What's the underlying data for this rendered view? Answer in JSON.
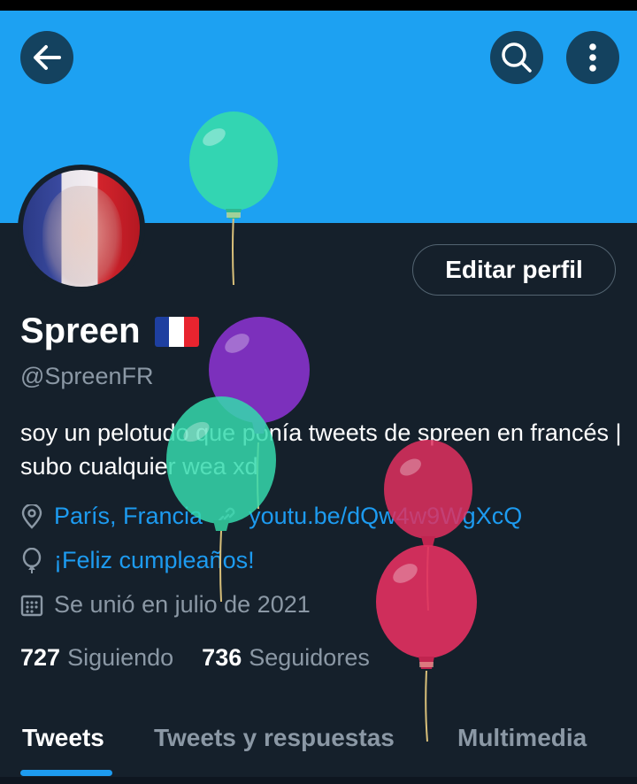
{
  "header": {
    "back_icon": "arrow-left-icon",
    "search_icon": "search-icon",
    "more_icon": "more-vertical-icon",
    "banner_color": "#1da1f2"
  },
  "profile": {
    "name": "Spreen",
    "handle": "@SpreenFR",
    "bio": "soy un pelotudo que ponía tweets de spreen en francés | subo cualquier wea xd",
    "edit_button": "Editar perfil",
    "location": "París, Francia",
    "website": "youtu.be/dQw4w9WgXcQ",
    "birthday": "¡Feliz cumpleaños!",
    "joined": "Se unió en julio de 2021",
    "following_count": "727",
    "following_label": "Siguiendo",
    "followers_count": "736",
    "followers_label": "Seguidores"
  },
  "tabs": [
    {
      "label": "Tweets",
      "active": true
    },
    {
      "label": "Tweets y respuestas",
      "active": false
    },
    {
      "label": "Multimedia",
      "active": false
    }
  ],
  "colors": {
    "background": "#15202b",
    "accent": "#1d9bf0",
    "muted": "#8b98a5"
  },
  "balloons": [
    {
      "color": "#35d9ad"
    },
    {
      "color": "#8b32d0"
    },
    {
      "color": "#35d9ad"
    },
    {
      "color": "#e0305f"
    },
    {
      "color": "#e0305f"
    }
  ]
}
